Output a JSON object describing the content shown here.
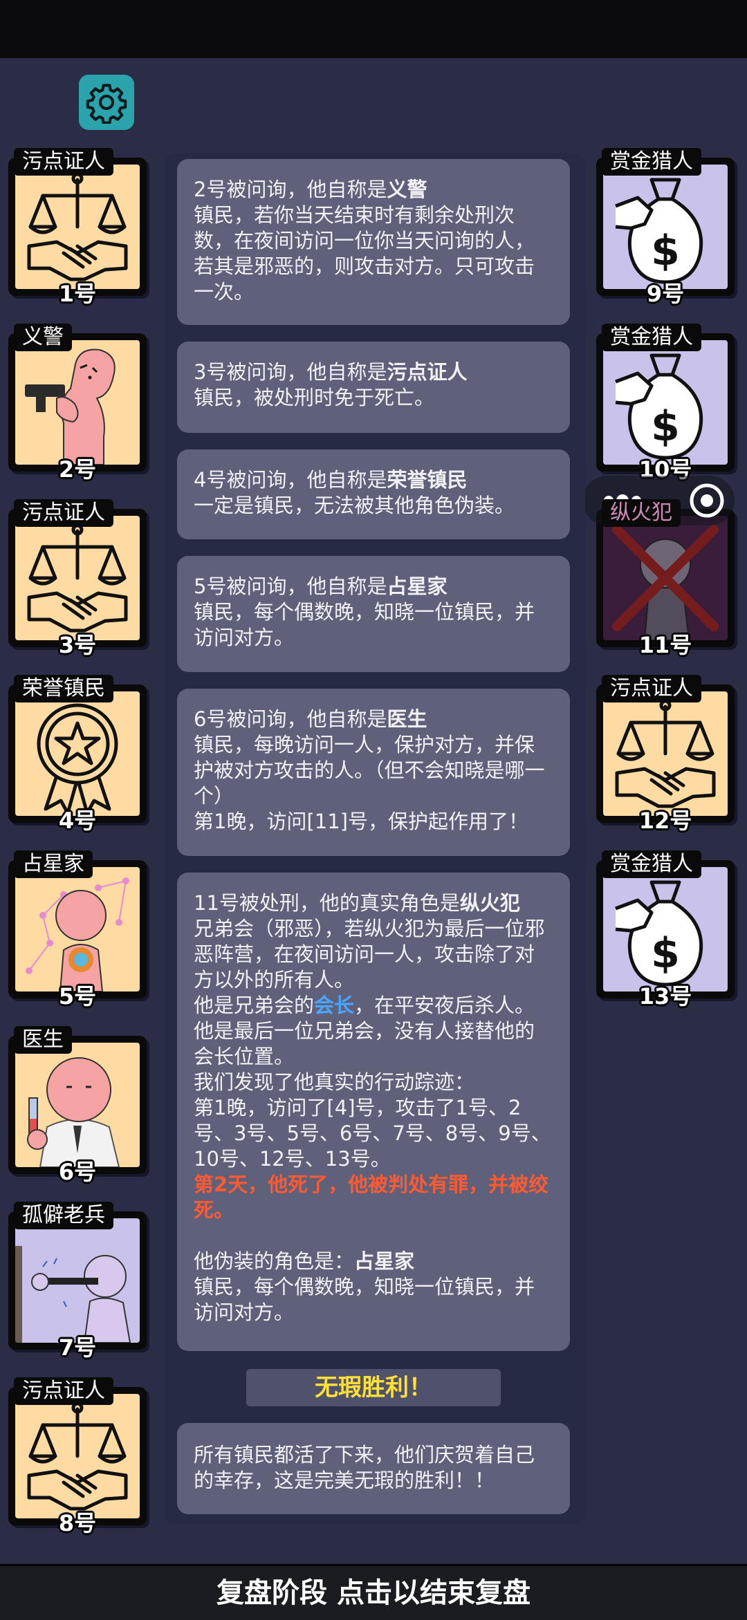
{
  "settings": {
    "icon": "gear-icon"
  },
  "left_cards": [
    {
      "role": "污点证人",
      "number": "1号",
      "art": "scales"
    },
    {
      "role": "义警",
      "number": "2号",
      "art": "gunman"
    },
    {
      "role": "污点证人",
      "number": "3号",
      "art": "scales"
    },
    {
      "role": "荣誉镇民",
      "number": "4号",
      "art": "medal"
    },
    {
      "role": "占星家",
      "number": "5号",
      "art": "astrologer"
    },
    {
      "role": "医生",
      "number": "6号",
      "art": "doctor"
    },
    {
      "role": "孤僻老兵",
      "number": "7号",
      "art": "veteran"
    },
    {
      "role": "污点证人",
      "number": "8号",
      "art": "scales"
    }
  ],
  "right_cards": [
    {
      "role": "赏金猎人",
      "number": "9号",
      "art": "moneybag"
    },
    {
      "role": "赏金猎人",
      "number": "10号",
      "art": "moneybag"
    },
    {
      "role": "纵火犯",
      "number": "11号",
      "art": "arsonist-crossed",
      "status": "dead"
    },
    {
      "role": "污点证人",
      "number": "12号",
      "art": "scales"
    },
    {
      "role": "赏金猎人",
      "number": "13号",
      "art": "moneybag"
    }
  ],
  "log": [
    {
      "prefix": "2号被问询，他自称是",
      "role": "义警",
      "desc": "镇民，若你当天结束时有剩余处刑次数，在夜间访问一位你当天问询的人，若其是邪恶的，则攻击对方。只可攻击一次。"
    },
    {
      "prefix": "3号被问询，他自称是",
      "role": "污点证人",
      "desc": "镇民，被处刑时免于死亡。"
    },
    {
      "prefix": "4号被问询，他自称是",
      "role": "荣誉镇民",
      "desc": "一定是镇民，无法被其他角色伪装。"
    },
    {
      "prefix": "5号被问询，他自称是",
      "role": "占星家",
      "desc": "镇民，每个偶数晚，知晓一位镇民，并访问对方。"
    },
    {
      "prefix": "6号被问询，他自称是",
      "role": "医生",
      "desc": "镇民，每晚访问一人，保护对方，并保护被对方攻击的人。（但不会知晓是哪一个）",
      "extra": "第1晚，访问[11]号，保护起作用了！"
    }
  ],
  "execution": {
    "line1_prefix": "11号被处刑，他的真实角色是",
    "line1_role": "纵火犯",
    "desc": "兄弟会（邪恶），若纵火犯为最后一位邪恶阵营，在夜间访问一人，攻击除了对方以外的所有人。",
    "leader_prefix": "他是兄弟会的",
    "leader_word": "会长",
    "leader_suffix": "，在平安夜后杀人。他是最后一位兄弟会，没有人接替他的会长位置。",
    "trace": "我们发现了他真实的行动踪迹：",
    "night1": "第1晚，访问了[4]号，攻击了1号、2号、3号、5号、6号、7号、8号、9号、10号、12号、13号。",
    "death": "第2天，他死了，他被判处有罪，并被绞死。",
    "disguise_prefix": "他伪装的角色是：",
    "disguise_role": "占星家",
    "disguise_desc": "镇民，每个偶数晚，知晓一位镇民，并访问对方。"
  },
  "victory_label": "无瑕胜利！",
  "final_message": "所有镇民都活了下来，他们庆贺着自己的幸存，这是完美无瑕的胜利！！",
  "bottom_bar_label": "复盘阶段 点击以结束复盘",
  "colors": {
    "accent_blue": "#4aa6ff",
    "alert_red": "#ff5a32",
    "victory_yellow": "#ffe033",
    "gear_teal": "#2aa3ad"
  }
}
